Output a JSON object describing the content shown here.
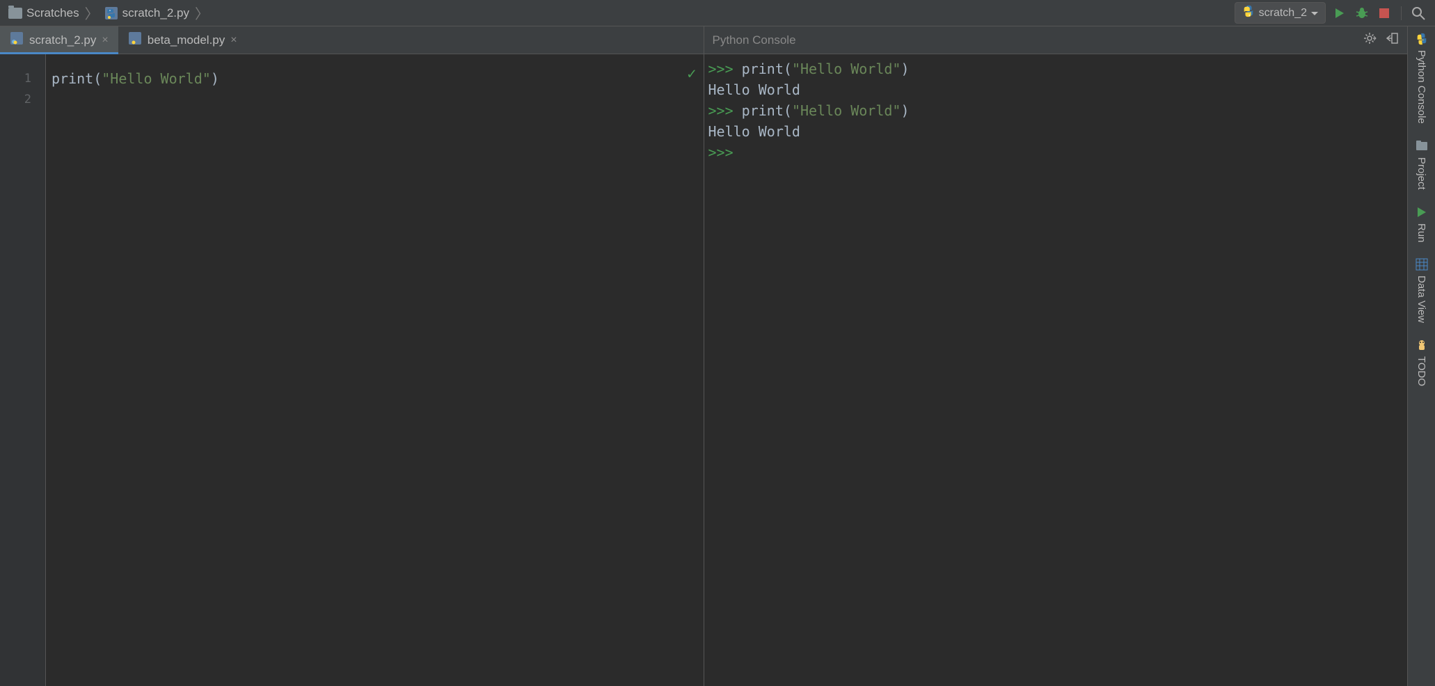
{
  "breadcrumbs": {
    "items": [
      {
        "label": "Scratches",
        "icon": "folder"
      },
      {
        "label": "scratch_2.py",
        "icon": "python"
      }
    ]
  },
  "run_config": {
    "label": "scratch_2"
  },
  "editor": {
    "tabs": [
      {
        "label": "scratch_2.py",
        "active": true
      },
      {
        "label": "beta_model.py",
        "active": false
      }
    ],
    "line_numbers": [
      "1",
      "2"
    ],
    "code": {
      "fn": "print",
      "open": "(",
      "str": "\"Hello World\"",
      "close": ")"
    }
  },
  "console": {
    "title": "Python Console",
    "lines": [
      {
        "type": "input",
        "prompt": ">>>",
        "fn": "print",
        "open": "(",
        "str": "\"Hello World\"",
        "close": ")"
      },
      {
        "type": "output",
        "text": "Hello World"
      },
      {
        "type": "input",
        "prompt": ">>>",
        "fn": "print",
        "open": "(",
        "str": "\"Hello World\"",
        "close": ")"
      },
      {
        "type": "output",
        "text": "Hello World"
      },
      {
        "type": "blank",
        "text": ""
      },
      {
        "type": "prompt_only",
        "prompt": ">>>"
      }
    ]
  },
  "right_sidebar": {
    "items": [
      {
        "label": "Python Console",
        "icon": "python"
      },
      {
        "label": "Project",
        "icon": "project"
      },
      {
        "label": "Run",
        "icon": "run"
      },
      {
        "label": "Data View",
        "icon": "dataview"
      },
      {
        "label": "TODO",
        "icon": "todo"
      }
    ]
  }
}
